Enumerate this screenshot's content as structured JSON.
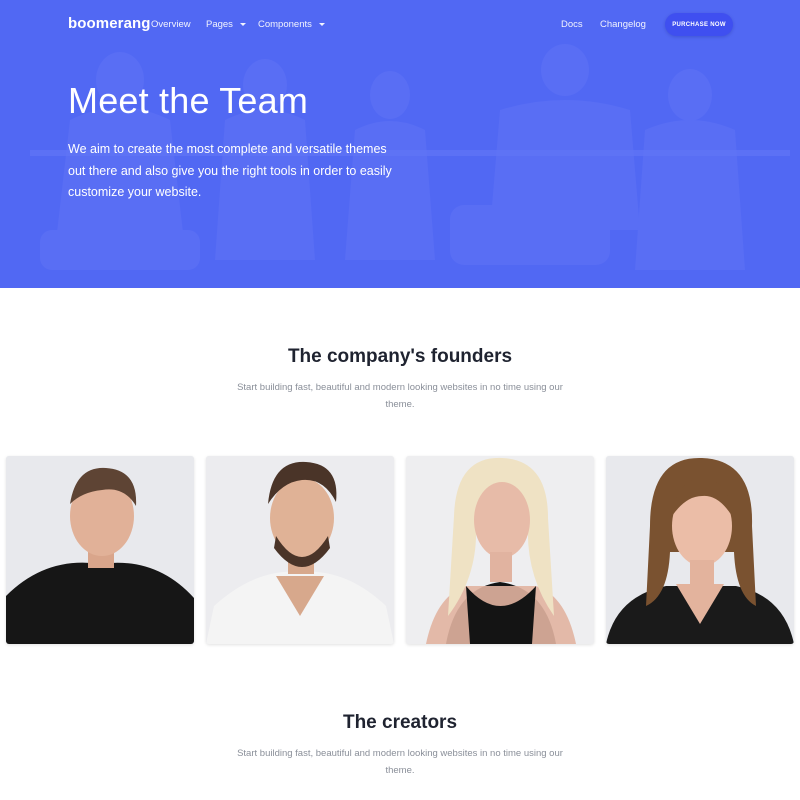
{
  "nav": {
    "brand": "boomerang",
    "links": [
      {
        "label": "Overview"
      },
      {
        "label": "Pages"
      },
      {
        "label": "Components"
      },
      {
        "label": "Docs"
      },
      {
        "label": "Changelog"
      }
    ],
    "purchase_label": "PURCHASE NOW"
  },
  "hero": {
    "title": "Meet the Team",
    "text": "We aim to create the most complete and versatile themes out there and also give you the right tools in order to easily customize your website."
  },
  "founders": {
    "title": "The company's founders",
    "subtitle": "Start building fast, beautiful and modern looking websites in no time using our theme."
  },
  "creators": {
    "title": "The creators",
    "subtitle": "Start building fast, beautiful and modern looking websites in no time using our theme."
  },
  "colors": {
    "hero_blue": "#4a62f2",
    "button_blue": "#3f4ff0",
    "muted_text": "#8a8f99"
  }
}
